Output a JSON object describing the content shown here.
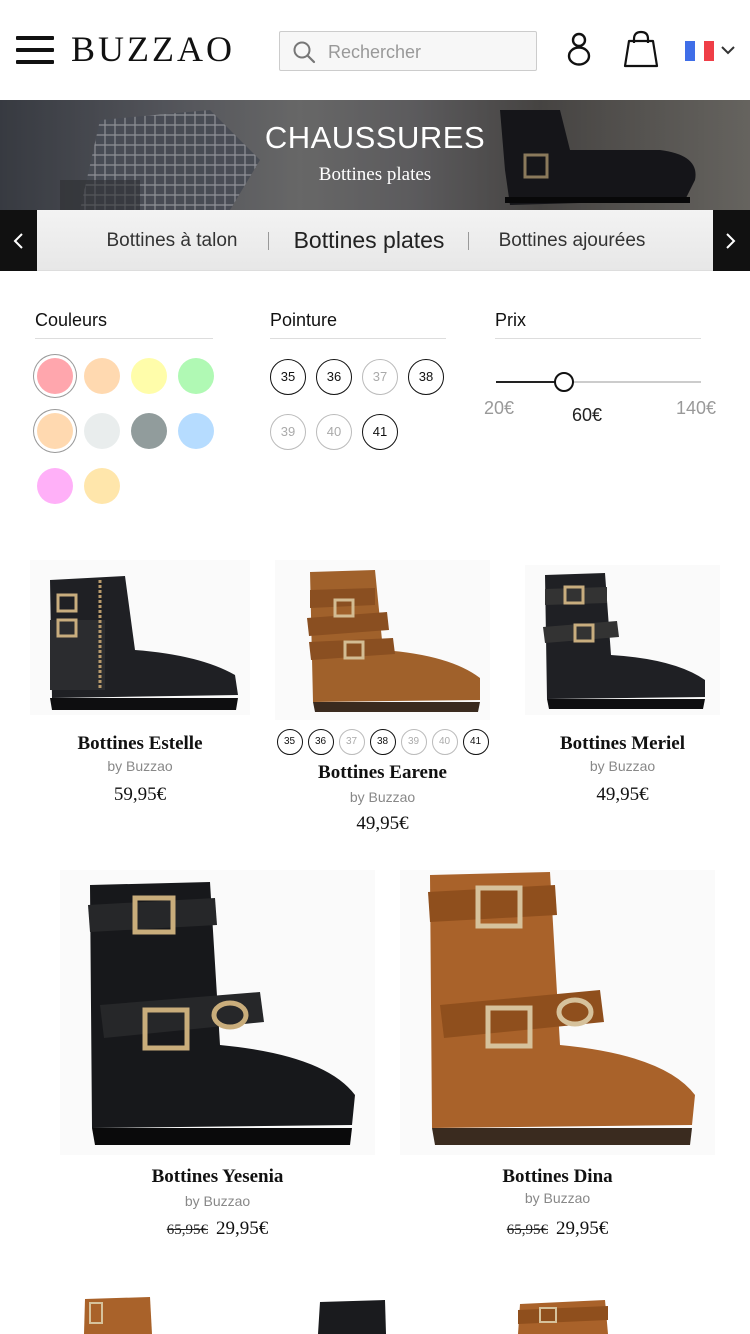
{
  "header": {
    "logo": "BUZZAO",
    "search_placeholder": "Rechercher",
    "flag_colors": [
      "#3f6ee8",
      "#ffffff",
      "#ef3e47"
    ]
  },
  "banner": {
    "title": "CHAUSSURES",
    "subtitle": "Bottines plates"
  },
  "category_tabs": [
    {
      "label": "Bottines à talon",
      "active": false
    },
    {
      "label": "Bottines plates",
      "active": true
    },
    {
      "label": "Bottines ajourées",
      "active": false
    }
  ],
  "filters": {
    "colors_title": "Couleurs",
    "colors": [
      {
        "hex": "#ffa6ad",
        "selected": true
      },
      {
        "hex": "#ffd9b0",
        "selected": false
      },
      {
        "hex": "#fffdaa",
        "selected": false
      },
      {
        "hex": "#b0f9b4",
        "selected": false
      },
      {
        "hex": "#ffd9b0",
        "selected": true
      },
      {
        "hex": "#e9eded",
        "selected": false
      },
      {
        "hex": "#919c9c",
        "selected": false
      },
      {
        "hex": "#b6dcff",
        "selected": false
      },
      {
        "hex": "#ffb0f8",
        "selected": false
      },
      {
        "hex": "#ffe6ab",
        "selected": false
      }
    ],
    "size_title": "Pointure",
    "sizes": [
      {
        "label": "35",
        "available": true
      },
      {
        "label": "36",
        "available": true
      },
      {
        "label": "37",
        "available": false
      },
      {
        "label": "38",
        "available": true
      },
      {
        "label": "39",
        "available": false
      },
      {
        "label": "40",
        "available": false
      },
      {
        "label": "41",
        "available": true
      }
    ],
    "price_title": "Prix",
    "price_min": "20€",
    "price_current": "60€",
    "price_max": "140€",
    "price_value": 60
  },
  "products": [
    {
      "name": "Bottines Estelle",
      "brand": "by Buzzao",
      "price": "59,95€",
      "old_price": ""
    },
    {
      "name": "Bottines Earene",
      "brand": "by Buzzao",
      "price": "49,95€",
      "old_price": "",
      "sizes": [
        {
          "label": "35",
          "available": true
        },
        {
          "label": "36",
          "available": true
        },
        {
          "label": "37",
          "available": false
        },
        {
          "label": "38",
          "available": true
        },
        {
          "label": "39",
          "available": false
        },
        {
          "label": "40",
          "available": false
        },
        {
          "label": "41",
          "available": true
        }
      ]
    },
    {
      "name": "Bottines Meriel",
      "brand": "by Buzzao",
      "price": "49,95€",
      "old_price": ""
    },
    {
      "name": "Bottines Yesenia",
      "brand": "by Buzzao",
      "price": "29,95€",
      "old_price": "65,95€"
    },
    {
      "name": "Bottines Dina",
      "brand": "by Buzzao",
      "price": "29,95€",
      "old_price": "65,95€"
    }
  ]
}
